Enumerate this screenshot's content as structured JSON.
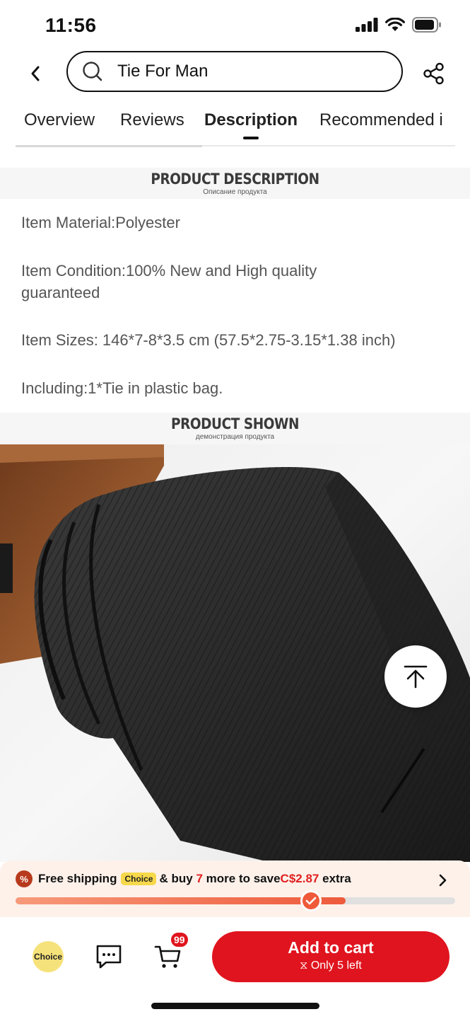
{
  "status_bar": {
    "time": "11:56"
  },
  "header": {
    "search_text": "Tie For Man"
  },
  "tabs": [
    {
      "label": "Overview"
    },
    {
      "label": "Reviews"
    },
    {
      "label": "Description"
    },
    {
      "label": "Recommended i"
    }
  ],
  "description_banner": {
    "title": "PRODUCT DESCRIPTION",
    "subtitle": "Описание продукта"
  },
  "description": {
    "material": "Item Material:Polyester",
    "condition": "Item Condition:100% New and High quality guaranteed",
    "sizes": "Item Sizes: 146*7-8*3.5 cm (57.5*2.75-3.15*1.38 inch)",
    "including": "Including:1*Tie in plastic bag."
  },
  "shown_banner": {
    "title": "PRODUCT SHOWN",
    "subtitle": "демонстрация продукта"
  },
  "promo": {
    "badge": "%",
    "free_shipping": "Free shipping",
    "choice_chip": "Choice",
    "buy_prefix": "& buy",
    "count": "7",
    "more_text": "more to save",
    "amount": "C$2.87",
    "suffix": "extra",
    "progress": 0.75
  },
  "bottom_bar": {
    "choice_label": "Choice",
    "cart_badge": "99",
    "cta_label": "Add to cart",
    "cta_sub": "⧖ Only 5 left"
  },
  "colors": {
    "accent": "#e0141e",
    "promo_bg": "#fdf1ea",
    "progress": "#ef5a3a"
  }
}
